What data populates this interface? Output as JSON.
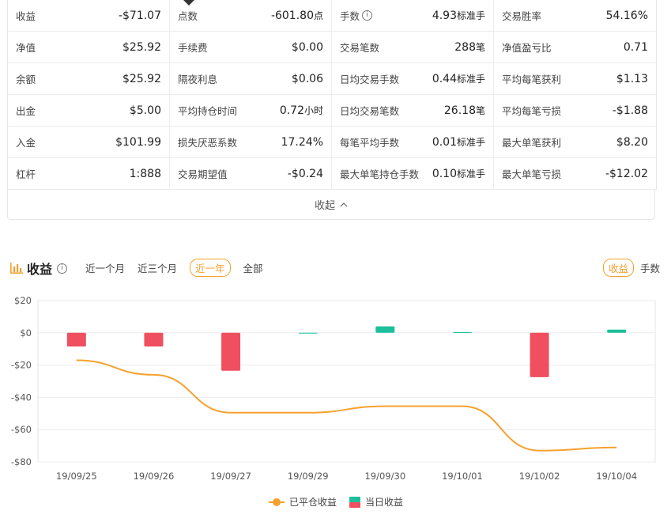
{
  "stats_rows": [
    [
      {
        "label": "收益",
        "value": "-$71.07",
        "unit": ""
      },
      {
        "label": "点数",
        "value": "-601.80",
        "unit": "点"
      },
      {
        "label": "手数",
        "value": "4.93",
        "unit": "标准手",
        "info": true
      },
      {
        "label": "交易胜率",
        "value": "54.16%",
        "unit": ""
      }
    ],
    [
      {
        "label": "净值",
        "value": "$25.92",
        "unit": ""
      },
      {
        "label": "手续费",
        "value": "$0.00",
        "unit": ""
      },
      {
        "label": "交易笔数",
        "value": "288",
        "unit": "笔"
      },
      {
        "label": "净值盈亏比",
        "value": "0.71",
        "unit": ""
      }
    ],
    [
      {
        "label": "余额",
        "value": "$25.92",
        "unit": ""
      },
      {
        "label": "隔夜利息",
        "value": "$0.06",
        "unit": ""
      },
      {
        "label": "日均交易手数",
        "value": "0.44",
        "unit": "标准手"
      },
      {
        "label": "平均每笔获利",
        "value": "$1.13",
        "unit": ""
      }
    ],
    [
      {
        "label": "出金",
        "value": "$5.00",
        "unit": ""
      },
      {
        "label": "平均持仓时间",
        "value": "0.72",
        "unit": "小时"
      },
      {
        "label": "日均交易笔数",
        "value": "26.18",
        "unit": "笔"
      },
      {
        "label": "平均每笔亏损",
        "value": "-$1.88",
        "unit": ""
      }
    ],
    [
      {
        "label": "入金",
        "value": "$101.99",
        "unit": ""
      },
      {
        "label": "损失厌恶系数",
        "value": "17.24%",
        "unit": ""
      },
      {
        "label": "每笔平均手数",
        "value": "0.01",
        "unit": "标准手"
      },
      {
        "label": "最大单笔获利",
        "value": "$8.20",
        "unit": ""
      }
    ],
    [
      {
        "label": "杠杆",
        "value": "1:888",
        "unit": ""
      },
      {
        "label": "交易期望值",
        "value": "-$0.24",
        "unit": ""
      },
      {
        "label": "最大单笔持仓手数",
        "value": "0.10",
        "unit": "标准手"
      },
      {
        "label": "最大单笔亏损",
        "value": "-$12.02",
        "unit": ""
      }
    ]
  ],
  "collapse_label": "收起",
  "section": {
    "title": "收益",
    "filters": [
      "近一个月",
      "近三个月",
      "近一年",
      "全部"
    ],
    "active_filter": "近一年",
    "toggles": [
      "收益",
      "手数"
    ],
    "active_toggle": "收益"
  },
  "colors": {
    "accent": "#f5a12e",
    "loss": "#ef4f5f",
    "gain": "#1dbf9b"
  },
  "chart_data": {
    "type": "bar",
    "categories": [
      "19/09/25",
      "19/09/26",
      "19/09/27",
      "19/09/29",
      "19/09/30",
      "19/10/01",
      "19/10/02",
      "19/10/04"
    ],
    "ylim": [
      -80,
      20
    ],
    "yticks": [
      "$20",
      "$0",
      "-$20",
      "-$40",
      "-$60",
      "-$80"
    ],
    "ytick_values": [
      20,
      0,
      -20,
      -40,
      -60,
      -80
    ],
    "series": [
      {
        "name": "当日收益",
        "type": "bar",
        "values": [
          -8.5,
          -8.5,
          -23.5,
          0,
          4.0,
          0.4,
          -27.5,
          2.0
        ]
      },
      {
        "name": "已平仓收益",
        "type": "line",
        "values": [
          -17,
          -26,
          -49.5,
          -49.5,
          -45.5,
          -45.5,
          -73,
          -71.07
        ]
      }
    ],
    "legend": [
      "已平仓收益",
      "当日收益"
    ],
    "grid": true
  }
}
